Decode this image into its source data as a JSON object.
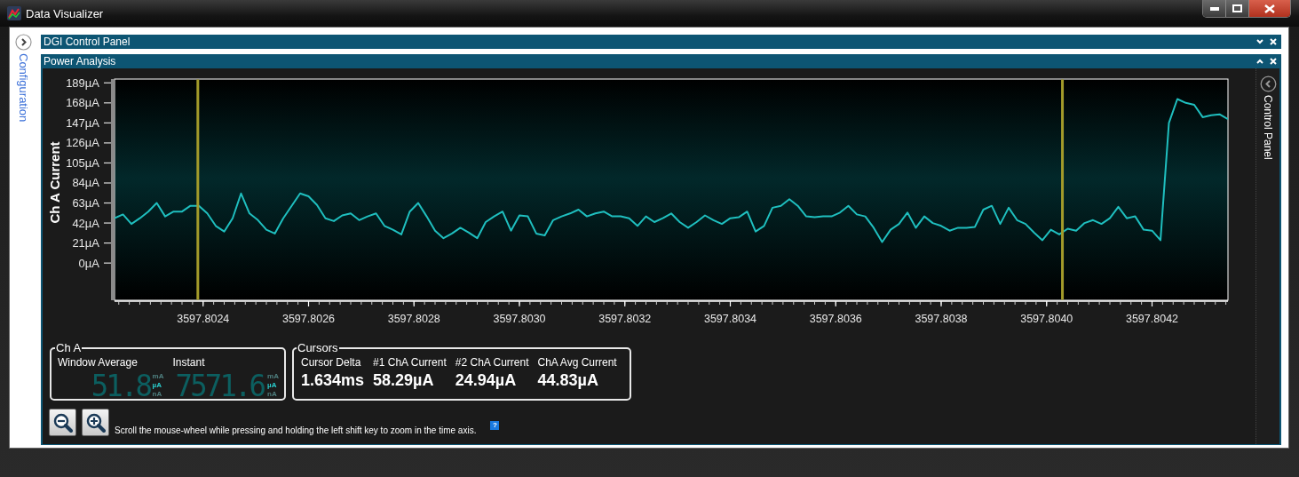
{
  "window": {
    "title": "Data Visualizer"
  },
  "sidebar": {
    "label": "Configuration"
  },
  "panels": [
    {
      "title": "DGI Control Panel",
      "expanded": false
    },
    {
      "title": "Power Analysis",
      "expanded": true
    }
  ],
  "power_analysis": {
    "chart": {
      "chart_data": {
        "type": "line",
        "ylabel": "Ch A Current",
        "x": [
          3597.802232,
          3597.802248,
          3597.802264,
          3597.80228,
          3597.802296,
          3597.802312,
          3597.802328,
          3597.802344,
          3597.80236,
          3597.802376,
          3597.802392,
          3597.802408,
          3597.802424,
          3597.80244,
          3597.802456,
          3597.802472,
          3597.802488,
          3597.802504,
          3597.80252,
          3597.802536,
          3597.802552,
          3597.802568,
          3597.802584,
          3597.8026,
          3597.802616,
          3597.802632,
          3597.802648,
          3597.802664,
          3597.80268,
          3597.802696,
          3597.802712,
          3597.802728,
          3597.802744,
          3597.80276,
          3597.802776,
          3597.802792,
          3597.802808,
          3597.802824,
          3597.80284,
          3597.802856,
          3597.802872,
          3597.802888,
          3597.802904,
          3597.80292,
          3597.802936,
          3597.802952,
          3597.802968,
          3597.802984,
          3597.803,
          3597.803016,
          3597.803032,
          3597.803048,
          3597.803064,
          3597.80308,
          3597.803096,
          3597.803112,
          3597.803128,
          3597.803144,
          3597.80316,
          3597.803176,
          3597.803192,
          3597.803208,
          3597.803224,
          3597.80324,
          3597.803256,
          3597.803272,
          3597.803288,
          3597.803304,
          3597.80332,
          3597.803336,
          3597.803352,
          3597.803368,
          3597.803384,
          3597.8034,
          3597.803416,
          3597.803432,
          3597.803448,
          3597.803464,
          3597.80348,
          3597.803496,
          3597.803512,
          3597.803528,
          3597.803544,
          3597.80356,
          3597.803576,
          3597.803592,
          3597.803608,
          3597.803624,
          3597.80364,
          3597.803656,
          3597.803672,
          3597.803688,
          3597.803704,
          3597.80372,
          3597.803736,
          3597.803752,
          3597.803768,
          3597.803784,
          3597.8038,
          3597.803816,
          3597.803832,
          3597.803848,
          3597.803864,
          3597.80388,
          3597.803896,
          3597.803912,
          3597.803928,
          3597.803944,
          3597.80396,
          3597.803976,
          3597.803992,
          3597.804008,
          3597.804024,
          3597.80404,
          3597.804056,
          3597.804072,
          3597.804088,
          3597.804104,
          3597.80412,
          3597.804136,
          3597.804152,
          3597.804168,
          3597.804184,
          3597.8042,
          3597.804216,
          3597.804232,
          3597.804248,
          3597.804264,
          3597.80428,
          3597.804296,
          3597.804312,
          3597.804328,
          3597.804344
        ],
        "series": [
          {
            "color": "#1fbfbf",
            "values": [
              47,
              51,
              41,
              47,
              54,
              63,
              49,
              54,
              54,
              60,
              60,
              52,
              39,
              33,
              47,
              73,
              52,
              45,
              35,
              31,
              47,
              60,
              73,
              70,
              61,
              47,
              44,
              50,
              52,
              45,
              49,
              52,
              39,
              35,
              30,
              54,
              63,
              49,
              34,
              26,
              31,
              37,
              32,
              26,
              43,
              49,
              54,
              34,
              50,
              49,
              31,
              29,
              45,
              49,
              52,
              56,
              49,
              52,
              54,
              49,
              49,
              47,
              39,
              49,
              43,
              47,
              52,
              43,
              37,
              43,
              50,
              45,
              41,
              47,
              48,
              54,
              33,
              39,
              58,
              60,
              67,
              60,
              49,
              48,
              49,
              49,
              53,
              60,
              51,
              49,
              37,
              22,
              35,
              41,
              53,
              37,
              49,
              42,
              39,
              34,
              37,
              37,
              38,
              56,
              60,
              41,
              58,
              45,
              41,
              32,
              24,
              35,
              30,
              36,
              34,
              42,
              45,
              41,
              47,
              59,
              47,
              49,
              35,
              34,
              24,
              147,
              172,
              168,
              166,
              153,
              155,
              156,
              151
            ]
          }
        ],
        "xlim": [
          3597.802232,
          3597.804344
        ],
        "ylim": [
          -39,
          193
        ],
        "xticks": [
          {
            "value": 3597.8024,
            "label": "3597.8024"
          },
          {
            "value": 3597.8026,
            "label": "3597.8026"
          },
          {
            "value": 3597.8028,
            "label": "3597.8028"
          },
          {
            "value": 3597.803,
            "label": "3597.8030"
          },
          {
            "value": 3597.8032,
            "label": "3597.8032"
          },
          {
            "value": 3597.8034,
            "label": "3597.8034"
          },
          {
            "value": 3597.8036,
            "label": "3597.8036"
          },
          {
            "value": 3597.8038,
            "label": "3597.8038"
          },
          {
            "value": 3597.804,
            "label": "3597.8040"
          },
          {
            "value": 3597.8042,
            "label": "3597.8042"
          }
        ],
        "yticks": [
          {
            "value": 189,
            "label": "189µA"
          },
          {
            "value": 168,
            "label": "168µA"
          },
          {
            "value": 147,
            "label": "147µA"
          },
          {
            "value": 126,
            "label": "126µA"
          },
          {
            "value": 105,
            "label": "105µA"
          },
          {
            "value": 84,
            "label": "84µA"
          },
          {
            "value": 63,
            "label": "63µA"
          },
          {
            "value": 42,
            "label": "42µA"
          },
          {
            "value": 21,
            "label": "21µA"
          },
          {
            "value": 0,
            "label": "0µA"
          }
        ],
        "ref_lines": [
          {
            "axis": "x",
            "value": 3597.80239,
            "color": "#a39b2a"
          },
          {
            "axis": "x",
            "value": 3597.80403,
            "color": "#a39b2a"
          }
        ]
      }
    },
    "control_panel": {
      "label": "Control Panel"
    },
    "channel_group": {
      "title": "Ch A",
      "readouts": [
        {
          "label": "Window Average",
          "value": "51.8",
          "units": [
            {
              "label": "mA",
              "selected": false
            },
            {
              "label": "µA",
              "selected": true
            },
            {
              "label": "nA",
              "selected": false
            }
          ]
        },
        {
          "label": "Instant",
          "value": "7571.6",
          "units": [
            {
              "label": "mA",
              "selected": false
            },
            {
              "label": "µA",
              "selected": true
            },
            {
              "label": "nA",
              "selected": false
            }
          ]
        }
      ]
    },
    "cursors_group": {
      "title": "Cursors",
      "items": [
        {
          "label": "Cursor Delta",
          "value": "1.634ms"
        },
        {
          "label": "#1 ChA Current",
          "value": "58.29µA"
        },
        {
          "label": "#2 ChA Current",
          "value": "24.94µA"
        },
        {
          "label": "ChA Avg Current",
          "value": "44.83µA"
        }
      ]
    },
    "zoom_buttons": [
      {
        "kind": "zoom-out"
      },
      {
        "kind": "zoom-in"
      }
    ],
    "hint": "Scroll the mouse-wheel while pressing and holding the left shift key to zoom in the time axis.",
    "help": "?"
  }
}
